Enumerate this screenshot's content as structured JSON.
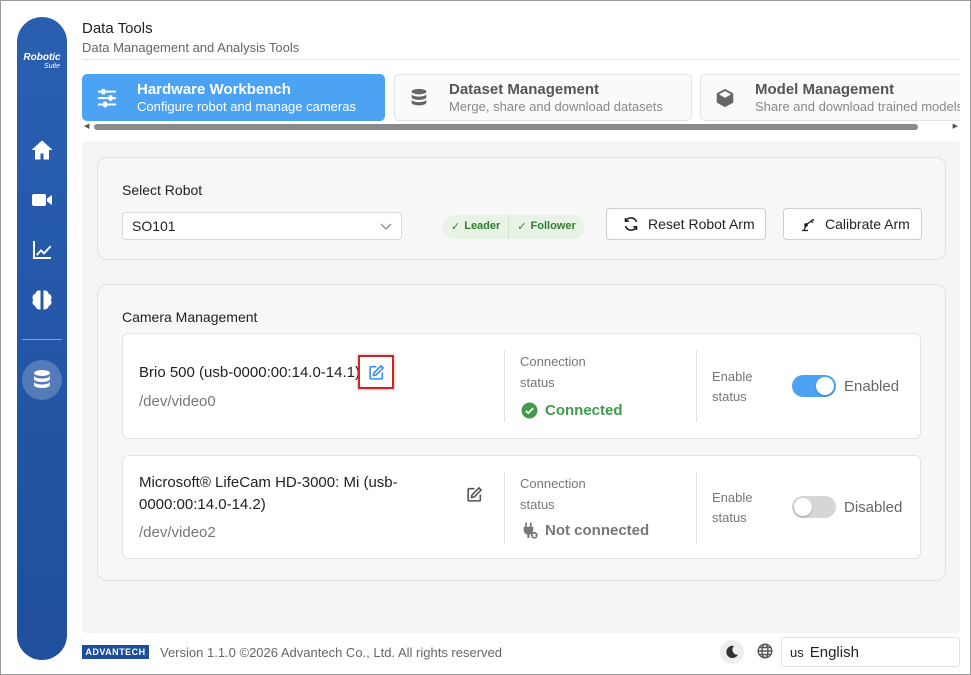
{
  "sidebar": {
    "logo_main": "Robotic",
    "logo_sub": "Suite",
    "items": [
      "home-icon",
      "video-camera-icon",
      "chart-icon",
      "brain-icon",
      "database-icon"
    ]
  },
  "header": {
    "title": "Data Tools",
    "subtitle": "Data Management and Analysis Tools"
  },
  "tabs": [
    {
      "title": "Hardware Workbench",
      "desc": "Configure robot and manage cameras",
      "icon": "sliders-icon",
      "active": true
    },
    {
      "title": "Dataset Management",
      "desc": "Merge, share and download datasets",
      "icon": "database-icon",
      "active": false
    },
    {
      "title": "Model Management",
      "desc": "Share and download trained models",
      "icon": "cube-icon",
      "active": false
    }
  ],
  "robot": {
    "section_title": "Select Robot",
    "selected": "SO101",
    "badges": {
      "leader": "Leader",
      "follower": "Follower"
    },
    "reset_label": "Reset Robot Arm",
    "calibrate_label": "Calibrate Arm"
  },
  "cameras": {
    "section_title": "Camera Management",
    "connection_label_1": "Connection",
    "connection_label_2": "status",
    "enable_label_1": "Enable",
    "enable_label_2": "status",
    "items": [
      {
        "name": "Brio 500 (usb-0000:00:14.0-14.1)",
        "path": "/dev/video0",
        "connection": "Connected",
        "enabled_label": "Enabled",
        "enabled": true
      },
      {
        "name_line1": "Microsoft® LifeCam HD-3000: Mi (usb-",
        "name_line2": "0000:00:14.0-14.2)",
        "path": "/dev/video2",
        "connection": "Not connected",
        "enabled_label": "Disabled",
        "enabled": false
      }
    ]
  },
  "footer": {
    "logo": "ADVANTECH",
    "version_text": "Version 1.1.0 ©2026 Advantech Co., Ltd. All rights reserved",
    "language_code": "us",
    "language": "English"
  },
  "colors": {
    "sidebar": "#1f4f9e",
    "accent": "#4da3f3",
    "success": "#3f9c4b",
    "highlight": "#d32222"
  }
}
